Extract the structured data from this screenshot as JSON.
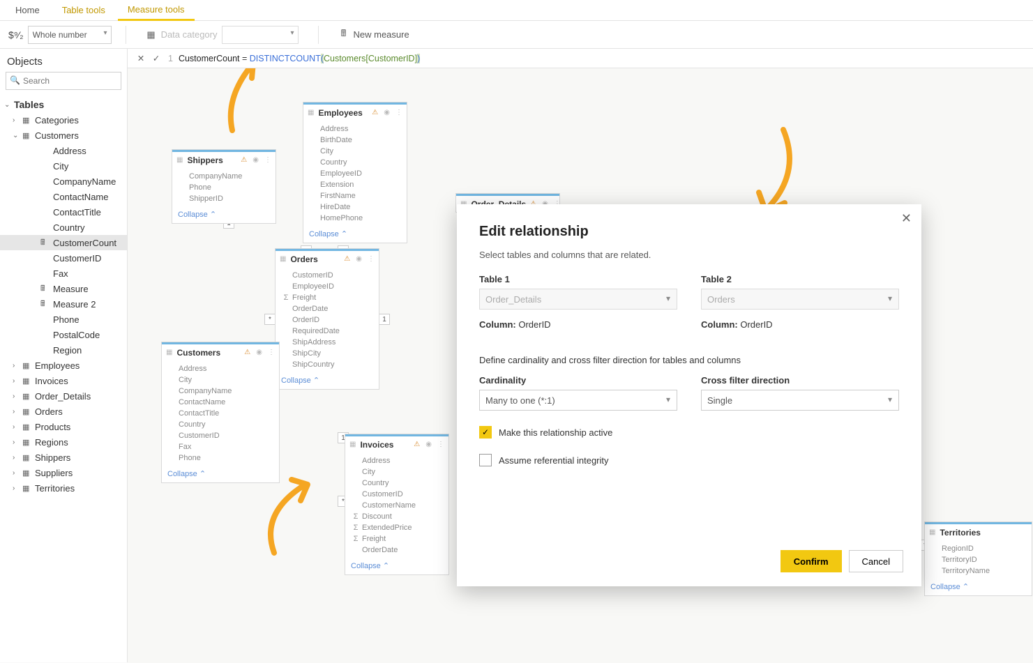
{
  "ribbon": {
    "tabs": {
      "home": "Home",
      "table_tools": "Table tools",
      "measure_tools": "Measure tools"
    },
    "format_value": "Whole number",
    "data_category_label": "Data category",
    "new_measure": "New measure"
  },
  "formula": {
    "line": "1",
    "name": "CustomerCount",
    "eq": " = ",
    "func": "DISTINCTCOUNT",
    "ref": "Customers[CustomerID]"
  },
  "panel": {
    "title": "Objects",
    "search_placeholder": "Search",
    "tables_label": "Tables",
    "tree": {
      "categories": "Categories",
      "customers": "Customers",
      "customer_fields": [
        "Address",
        "City",
        "CompanyName",
        "ContactName",
        "ContactTitle",
        "Country",
        "CustomerCount",
        "CustomerID",
        "Fax",
        "Measure",
        "Measure 2",
        "Phone",
        "PostalCode",
        "Region"
      ],
      "employees": "Employees",
      "invoices": "Invoices",
      "order_details": "Order_Details",
      "orders": "Orders",
      "products": "Products",
      "regions": "Regions",
      "shippers": "Shippers",
      "suppliers": "Suppliers",
      "territories": "Territories"
    }
  },
  "cards": {
    "shippers": {
      "title": "Shippers",
      "fields": [
        "CompanyName",
        "Phone",
        "ShipperID"
      ],
      "collapse": "Collapse"
    },
    "employees": {
      "title": "Employees",
      "fields": [
        "Address",
        "BirthDate",
        "City",
        "Country",
        "EmployeeID",
        "Extension",
        "FirstName",
        "HireDate",
        "HomePhone"
      ],
      "collapse": "Collapse"
    },
    "orders": {
      "title": "Orders",
      "fields": [
        "CustomerID",
        "EmployeeID",
        "Freight",
        "OrderDate",
        "OrderID",
        "RequiredDate",
        "ShipAddress",
        "ShipCity",
        "ShipCountry"
      ],
      "sigma_idx": 2,
      "collapse": "Collapse"
    },
    "customers": {
      "title": "Customers",
      "fields": [
        "Address",
        "City",
        "CompanyName",
        "ContactName",
        "ContactTitle",
        "Country",
        "CustomerID",
        "Fax",
        "Phone"
      ],
      "collapse": "Collapse"
    },
    "order_details": {
      "title": "Order_Details"
    },
    "invoices": {
      "title": "Invoices",
      "fields": [
        "Address",
        "City",
        "Country",
        "CustomerID",
        "CustomerName",
        "Discount",
        "ExtendedPrice",
        "Freight",
        "OrderDate"
      ],
      "sigma": [
        5,
        6,
        7
      ],
      "collapse": "Collapse"
    },
    "territories": {
      "title": "Territories",
      "fields": [
        "RegionID",
        "TerritoryID",
        "TerritoryName"
      ],
      "collapse": "Collapse"
    }
  },
  "modal": {
    "title": "Edit relationship",
    "subtitle": "Select tables and columns that are related.",
    "table1_label": "Table 1",
    "table1_value": "Order_Details",
    "table2_label": "Table 2",
    "table2_value": "Orders",
    "column_label": "Column:",
    "column1_value": "OrderID",
    "column2_value": "OrderID",
    "define_text": "Define cardinality and cross filter direction for tables and columns",
    "cardinality_label": "Cardinality",
    "cardinality_value": "Many to one (*:1)",
    "crossfilter_label": "Cross filter direction",
    "crossfilter_value": "Single",
    "chk_active": "Make this relationship active",
    "chk_ref": "Assume referential integrity",
    "confirm": "Confirm",
    "cancel": "Cancel"
  },
  "rel_markers": {
    "one": "1",
    "many": "*"
  }
}
